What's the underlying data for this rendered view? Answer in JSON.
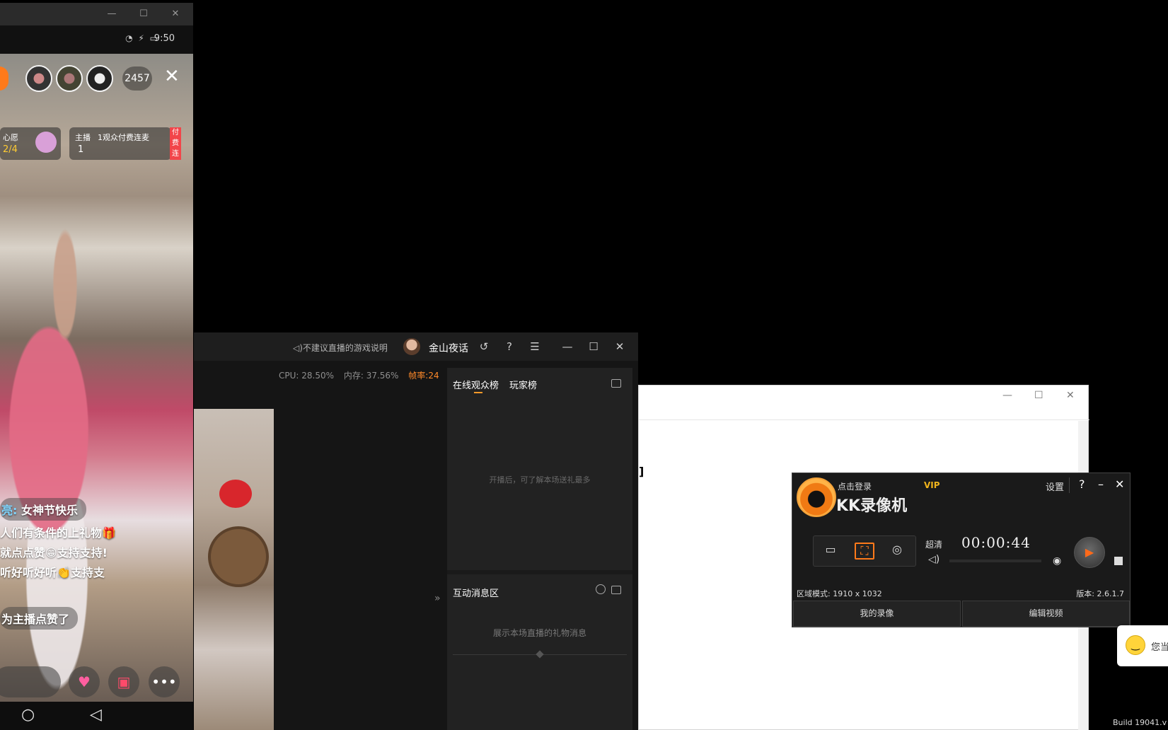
{
  "phone": {
    "status_time": "9:50",
    "viewer_count": "2457",
    "close_glyph": "✕",
    "wish_label": "心愿",
    "wish_progress": "2/4",
    "host_label": "主播",
    "host_desc": "1观众付费连麦",
    "host_progress": "1",
    "paid_tag": "付费连",
    "chat": [
      "女神节快乐",
      "人们有条件的上礼物🎁",
      "就点点赞😁支持支持!",
      "听好听好听👏支持支"
    ],
    "chat_prefix": "亮:",
    "like_notice": "为主播点赞了"
  },
  "stream_tool": {
    "game_notice": "不建议直播的游戏说明",
    "user_name": "金山夜话",
    "stats": {
      "cpu": "CPU: 28.50%",
      "mem": "内存: 37.56%",
      "fps": "帧率:24"
    },
    "tabs": [
      "在线观众榜",
      "玩家榜"
    ],
    "audience_empty": "开播后，可了解本场送礼最多",
    "interact_title": "互动消息区",
    "interact_empty": "展示本场直播的礼物消息"
  },
  "white_window": {
    "bracket": "]"
  },
  "kk": {
    "login": "点击登录",
    "vip": "VIP",
    "title": "KK录像机",
    "settings": "设置",
    "help": "?",
    "minimize": "–",
    "close": "✕",
    "quality": "超清",
    "timer": "00:00:44",
    "region": "区域模式: 1910 x 1032",
    "version": "版本: 2.6.1.7",
    "my_recordings": "我的录像",
    "edit_video": "编辑视频"
  },
  "toast": {
    "text": "您当"
  },
  "build": "Build 19041.v"
}
